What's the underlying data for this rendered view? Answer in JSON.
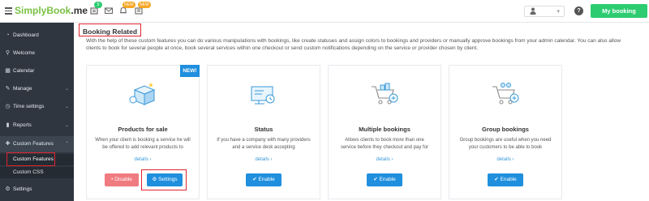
{
  "topbar": {
    "logo_main": "SimplyBook",
    "logo_suffix": ".me",
    "badges": [
      "5",
      "NEW",
      "NEW"
    ],
    "user_icon": "user-icon",
    "help_label": "?",
    "my_booking_label": "My booking website"
  },
  "sidebar": {
    "items": [
      {
        "label": "Dashboard",
        "icon": "dashboard-icon"
      },
      {
        "label": "Welcome",
        "icon": "location-pin-icon"
      },
      {
        "label": "Calendar",
        "icon": "calendar-icon"
      },
      {
        "label": "Manage",
        "icon": "wrench-icon"
      },
      {
        "label": "Time settings",
        "icon": "clock-icon"
      },
      {
        "label": "Reports",
        "icon": "bar-chart-icon"
      },
      {
        "label": "Custom Features",
        "icon": "gift-icon"
      },
      {
        "label": "Settings",
        "icon": "gear-icon"
      }
    ],
    "sub_items": [
      {
        "label": "Custom Features"
      },
      {
        "label": "Custom CSS"
      }
    ]
  },
  "main": {
    "section_title": "Booking Related",
    "description": "With the help of these custom features you can do various manipulations with bookings, like create statuses and assign colors to bookings and providers or manually approve bookings from your admin calendar. You can also allow clients to book for several people at once, book several services within one checkout or send custom notifications depending on the service or provider chosen by client.",
    "cards": [
      {
        "title": "Products for sale",
        "text": "When your client is booking a service he will be offered to add relevant products to",
        "details": "details  ›",
        "badge": "NEW!",
        "disable_label": "• Disable",
        "settings_label": "⚙ Settings"
      },
      {
        "title": "Status",
        "text": "If you have a company with many providers and a service desk accepting",
        "details": "details  ›",
        "enable_label": "✔ Enable"
      },
      {
        "title": "Multiple bookings",
        "text": "Allows clients to book more than one service before they checkout and pay for",
        "details": "details  ›",
        "enable_label": "✔ Enable"
      },
      {
        "title": "Group bookings",
        "text": "Group bookings are useful when you need your customers to be able to book",
        "details": "details  ›",
        "enable_label": "✔ Enable"
      }
    ]
  },
  "colors": {
    "accent_blue": "#1f8fde",
    "brand_green": "#2ecc71",
    "sidebar_bg": "#2f3640",
    "highlight_red": "#e0242f"
  }
}
